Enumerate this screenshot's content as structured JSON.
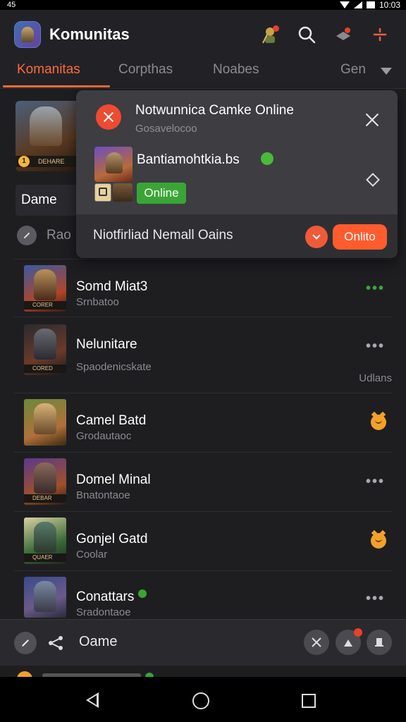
{
  "status_bar": {
    "left_text": "45",
    "time": "10:03"
  },
  "header": {
    "title": "Komunitas"
  },
  "tabs": [
    {
      "label": "Komanitas"
    },
    {
      "label": "Corpthas"
    },
    {
      "label": "Noabes"
    },
    {
      "label": "Gen"
    }
  ],
  "side": {
    "feature_tag": "DEHARE",
    "feature_num": "1",
    "label": "Dame",
    "search_text": "Rao"
  },
  "popup": {
    "title": "Notwunnica Camke Online",
    "subtitle": "Gosavelocoo",
    "user_name": "Bantiamohtkia.bs",
    "online_badge": "Online",
    "notification_text": "Niotfirliad Nemall Oains",
    "cta_label": "Onlito"
  },
  "list": [
    {
      "title": "Somd Miat3",
      "subtitle": "Srnbatoo",
      "tag": "CORER",
      "meta": ""
    },
    {
      "title": "Nelunitare",
      "subtitle": "Spaodenicskate",
      "tag": "CORED",
      "meta": "Udlans"
    },
    {
      "title": "Camel Batd",
      "subtitle": "Grodautaoc",
      "tag": "",
      "meta": ""
    },
    {
      "title": "Domel Minal",
      "subtitle": "Bnatontaoe",
      "tag": "DEBAR",
      "meta": ""
    },
    {
      "title": "Gonjel Gatd",
      "subtitle": "Coolar",
      "tag": "QUAER",
      "meta": ""
    },
    {
      "title": "Conattars",
      "subtitle": "Sradontaoe",
      "tag": "",
      "meta": ""
    }
  ],
  "bottom_bar": {
    "label": "Oame"
  },
  "colors": {
    "accent": "#ff6a3a",
    "online_green": "#3aa536",
    "background": "#1e1e21"
  }
}
